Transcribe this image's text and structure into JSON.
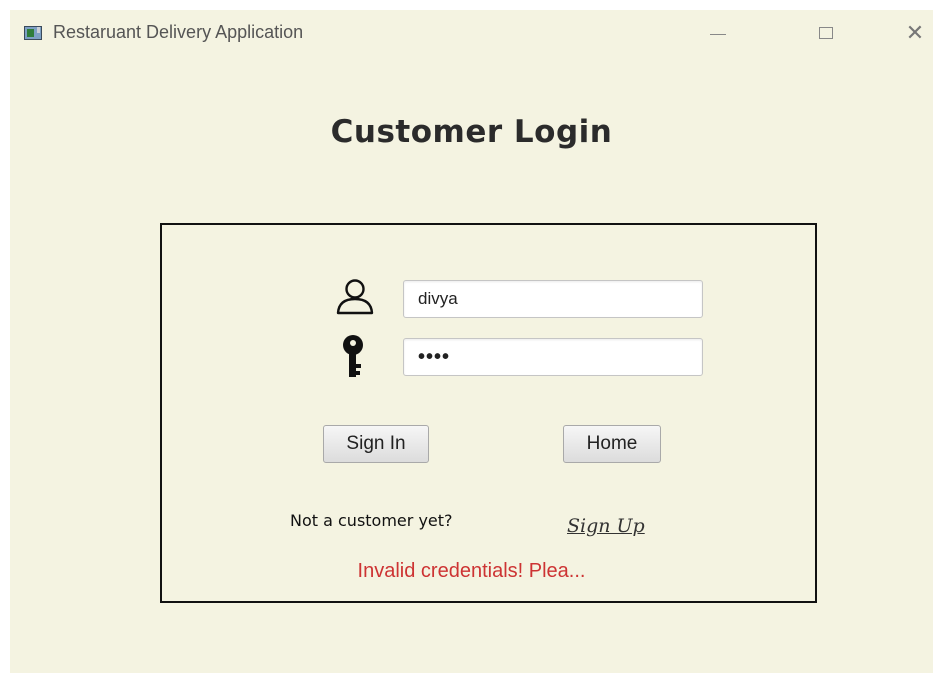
{
  "window": {
    "title": "Restaruant Delivery Application",
    "icon": "app-window-icon",
    "controls": [
      "minimize",
      "maximize",
      "close"
    ],
    "close_glyph": "✕"
  },
  "login": {
    "title": "Customer Login",
    "username_icon": "user-icon",
    "username_value": "divya",
    "password_icon": "key-icon",
    "password_masked": "••••",
    "signin_label": "Sign In",
    "home_label": "Home",
    "signup_prompt": "Not a customer yet?",
    "signup_link": "Sign Up",
    "error_message": "Invalid credentials! Plea..."
  },
  "colors": {
    "background": "#f4f3e1",
    "error": "#cd3333",
    "border": "#111111"
  }
}
